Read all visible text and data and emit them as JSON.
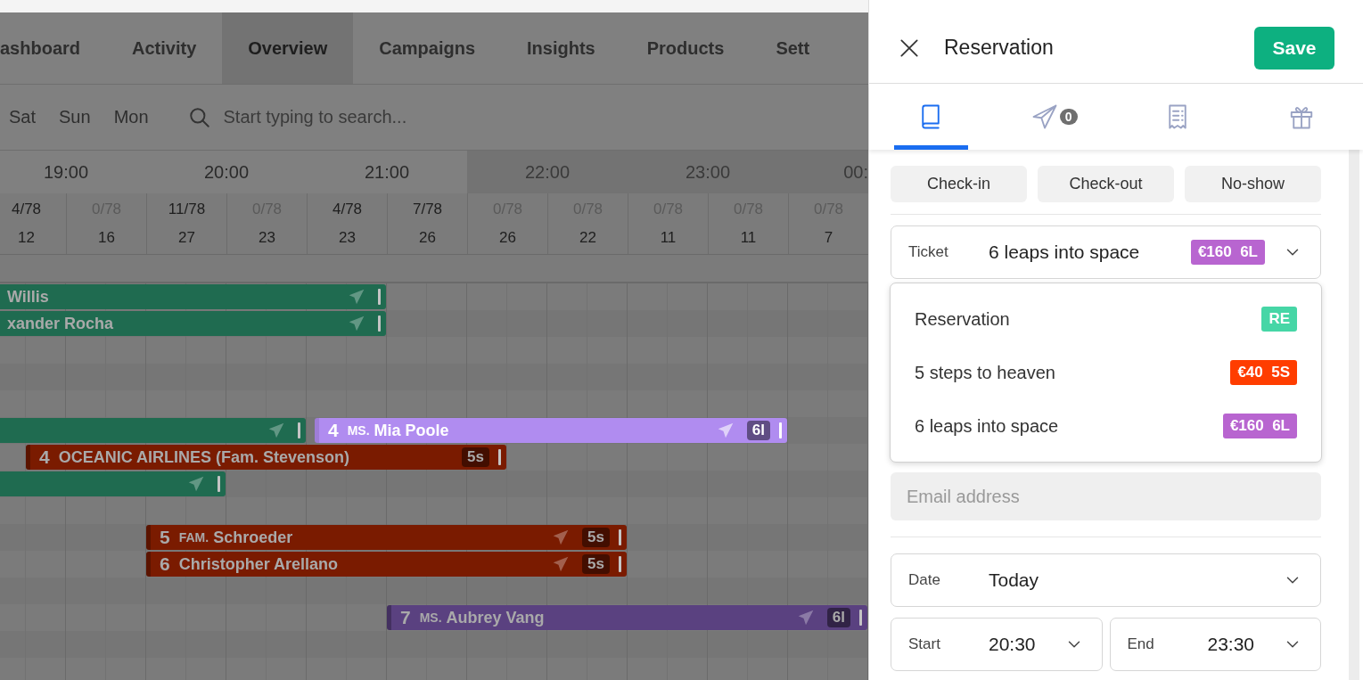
{
  "nav": {
    "tabs": [
      {
        "label": "ashboard",
        "selected": false
      },
      {
        "label": "Activity",
        "selected": false
      },
      {
        "label": "Overview",
        "selected": true
      },
      {
        "label": "Campaigns",
        "selected": false
      },
      {
        "label": "Insights",
        "selected": false
      },
      {
        "label": "Products",
        "selected": false
      },
      {
        "label": "Sett",
        "selected": false
      }
    ]
  },
  "toolbar": {
    "days": [
      "Sat",
      "Sun",
      "Mon"
    ],
    "search": {
      "placeholder": "Start typing to search..."
    }
  },
  "timeline": {
    "hours": [
      {
        "label": "19:00",
        "shaded": false
      },
      {
        "label": "20:00",
        "shaded": false
      },
      {
        "label": "21:00",
        "shaded": false
      },
      {
        "label": "22:00",
        "shaded": true
      },
      {
        "label": "23:00",
        "shaded": true
      },
      {
        "label": "00:",
        "shaded": true
      }
    ],
    "slots": [
      {
        "booked": "4/78",
        "guests": "12",
        "empty": false
      },
      {
        "booked": "0/78",
        "guests": "16",
        "empty": true
      },
      {
        "booked": "11/78",
        "guests": "27",
        "empty": false
      },
      {
        "booked": "0/78",
        "guests": "23",
        "empty": true
      },
      {
        "booked": "4/78",
        "guests": "23",
        "empty": false
      },
      {
        "booked": "7/78",
        "guests": "26",
        "empty": false
      },
      {
        "booked": "0/78",
        "guests": "26",
        "empty": true
      },
      {
        "booked": "0/78",
        "guests": "22",
        "empty": true
      },
      {
        "booked": "0/78",
        "guests": "11",
        "empty": true
      },
      {
        "booked": "0/78",
        "guests": "11",
        "empty": true
      },
      {
        "booked": "0/78",
        "guests": "7",
        "empty": true
      }
    ],
    "bookings": [
      {
        "color": "#1f6b50",
        "name": "Willis",
        "sent": true,
        "selected": false
      },
      {
        "color": "#1f6b50",
        "name": "xander Rocha",
        "sent": true,
        "selected": false
      },
      {
        "color": "#1f6b50",
        "sent": true,
        "selected": false
      },
      {
        "color": "#b08cf0",
        "number": "4",
        "prefix": "MS.",
        "name": "Mia Poole",
        "sent": true,
        "badge": "6l",
        "selected": true
      },
      {
        "color": "#7a1b00",
        "number": "4",
        "name": "OCEANIC AIRLINES (Fam. Stevenson)",
        "sent": false,
        "badge": "5s",
        "selected": false
      },
      {
        "color": "#1f6b50",
        "sent": true,
        "selected": false
      },
      {
        "color": "#7a1b00",
        "number": "5",
        "prefix": "FAM.",
        "name": "Schroeder",
        "sent": true,
        "badge": "5s",
        "selected": false
      },
      {
        "color": "#7a1b00",
        "number": "6",
        "name": "Christopher Arellano",
        "sent": true,
        "badge": "5s",
        "selected": false
      },
      {
        "color": "#5a4180",
        "number": "7",
        "prefix": "MS.",
        "name": "Aubrey Vang",
        "sent": true,
        "badge": "6l",
        "selected": false
      }
    ]
  },
  "panel": {
    "title": "Reservation",
    "save": "Save",
    "tabs": [
      {
        "kind": "book",
        "selected": true
      },
      {
        "kind": "plane",
        "selected": false,
        "count": "0"
      },
      {
        "kind": "receipt",
        "selected": false
      },
      {
        "kind": "gift",
        "selected": false
      }
    ],
    "actions": [
      "Check-in",
      "Check-out",
      "No-show"
    ],
    "ticket": {
      "label": "Ticket",
      "value": "6 leaps into space",
      "badge": "€160  6L",
      "color": "#b865d0"
    },
    "ticket_options": [
      {
        "label": "Reservation",
        "badge": "RE",
        "color": "#46d6a6"
      },
      {
        "label": "5 steps to heaven",
        "badge": "€40  5S",
        "color": "#ff3d00"
      },
      {
        "label": "6 leaps into space",
        "badge": "€160  6L",
        "color": "#b865d0"
      }
    ],
    "email": {
      "placeholder": "Email address"
    },
    "date": {
      "label": "Date",
      "value": "Today"
    },
    "start": {
      "label": "Start",
      "value": "20:30"
    },
    "end": {
      "label": "End",
      "value": "23:30"
    }
  }
}
